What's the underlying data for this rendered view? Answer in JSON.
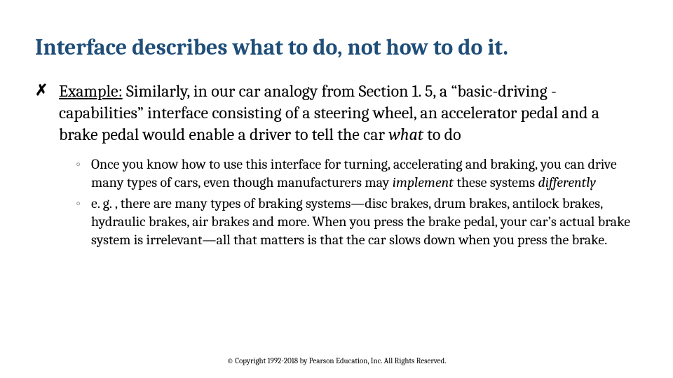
{
  "title": "Interface describes what to do, not how to do it.",
  "bullets": [
    {
      "label": "Example:",
      "text_a": " Similarly, in our car analogy from Section 1. 5, a “basic-driving -capabilities” interface consisting of a steering wheel, an accelerator pedal and a brake pedal would enable a driver to tell the car ",
      "italic_a": "what",
      "text_b": " to do"
    }
  ],
  "subbullets": [
    {
      "pre": "Once you know how to use this interface for turning, accelerating and braking, you can drive many types of cars, even though manufacturers may ",
      "it1": "implement",
      "mid": " these systems ",
      "it2": "differently",
      "post": ""
    },
    {
      "pre": "e. g. , there are many types of braking systems—disc brakes, drum brakes, antilock brakes, hydraulic brakes, air brakes and more. When you press the brake pedal, your car’s actual brake system is irrelevant—all that matters is that the car slows down when you press the brake.",
      "it1": "",
      "mid": "",
      "it2": "",
      "post": ""
    }
  ],
  "footer": "© Copyright 1992-2018 by Pearson Education, Inc. All Rights Reserved."
}
